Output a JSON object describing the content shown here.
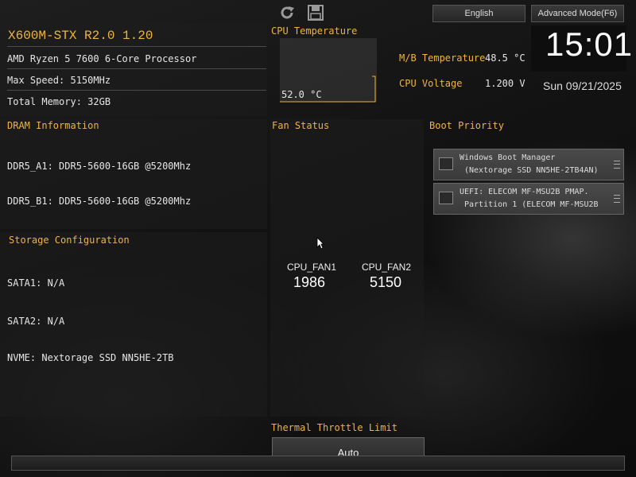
{
  "header": {
    "language_button": "English",
    "advanced_mode_button": "Advanced Mode(F6)"
  },
  "system": {
    "board_title": "X600M-STX R2.0 1.20",
    "cpu_name": "AMD Ryzen 5 7600 6-Core Processor",
    "max_speed": "Max Speed: 5150MHz",
    "total_memory": "Total Memory: 32GB"
  },
  "cpu_temperature": {
    "label": "CPU Temperature",
    "value": "52.0 °C"
  },
  "mb_temperature": {
    "label": "M/B Temperature",
    "value": "48.5 °C"
  },
  "cpu_voltage": {
    "label": "CPU Voltage",
    "value": "1.200 V"
  },
  "clock": {
    "time": "15:01",
    "date": "Sun 09/21/2025"
  },
  "dram": {
    "title": "DRAM Information",
    "slots": [
      "DDR5_A1: DDR5-5600-16GB @5200Mhz",
      "DDR5_B1: DDR5-5600-16GB @5200Mhz"
    ]
  },
  "storage": {
    "title": "Storage Configuration",
    "items": [
      "SATA1: N/A",
      "SATA2: N/A",
      "NVME: Nextorage SSD NN5HE-2TB"
    ]
  },
  "fan_status": {
    "title": "Fan Status",
    "fans": [
      {
        "name": "CPU_FAN1",
        "rpm": "1986"
      },
      {
        "name": "CPU_FAN2",
        "rpm": "5150"
      }
    ]
  },
  "boot_priority": {
    "title": "Boot Priority",
    "items": [
      {
        "line1": "Windows Boot Manager",
        "line2": "(Nextorage SSD NN5HE-2TB4AN)"
      },
      {
        "line1": "UEFI: ELECOM MF-MSU2B PMAP.",
        "line2": "Partition 1 (ELECOM MF-MSU2B"
      }
    ]
  },
  "thermal_throttle": {
    "label": "Thermal Throttle Limit",
    "value": "Auto"
  },
  "colors": {
    "accent": "#f0b43c",
    "text": "#e6e6e6"
  },
  "icons": [
    "refresh-icon",
    "save-icon",
    "disk-icon",
    "drag-handle-icon",
    "mouse-cursor-icon"
  ]
}
